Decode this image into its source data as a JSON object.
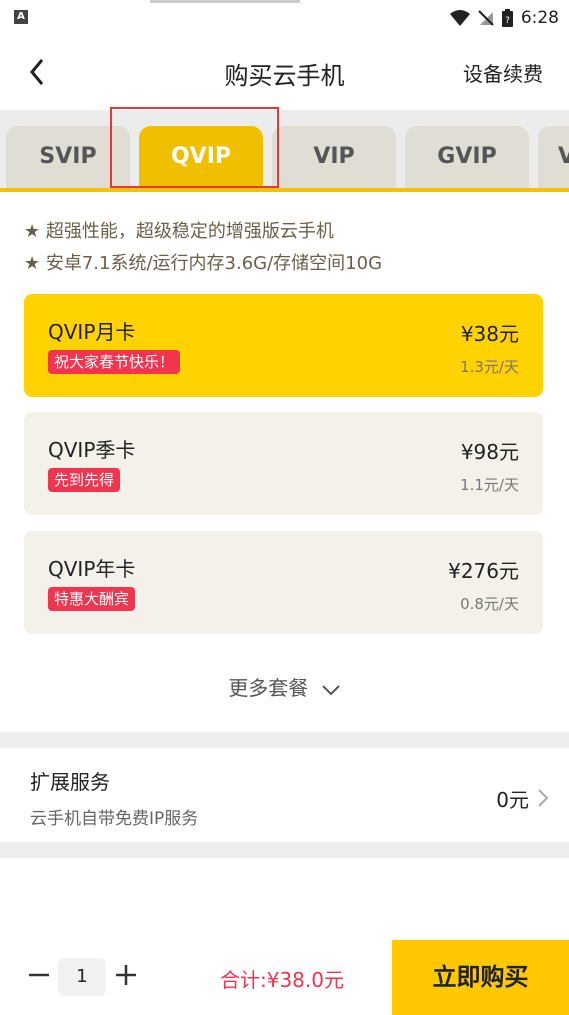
{
  "status_bar": {
    "time": "6:28"
  },
  "nav": {
    "title": "购买云手机",
    "right_action": "设备续费"
  },
  "tabs": [
    {
      "label": "SVIP",
      "active": false
    },
    {
      "label": "QVIP",
      "active": true
    },
    {
      "label": "VIP",
      "active": false
    },
    {
      "label": "GVIP",
      "active": false
    },
    {
      "label": "V",
      "active": false
    }
  ],
  "features": [
    "★ 超强性能，超级稳定的增强版云手机",
    "★ 安卓7.1系统/运行内存3.6G/存储空间10G"
  ],
  "plans": [
    {
      "name": "QVIP月卡",
      "badge": "祝大家春节快乐！",
      "price": "¥38元",
      "daily": "1.3元/天",
      "selected": true
    },
    {
      "name": "QVIP季卡",
      "badge": "先到先得",
      "price": "¥98元",
      "daily": "1.1元/天",
      "selected": false
    },
    {
      "name": "QVIP年卡",
      "badge": "特惠大酬宾",
      "price": "¥276元",
      "daily": "0.8元/天",
      "selected": false
    }
  ],
  "more_label": "更多套餐",
  "extension": {
    "title": "扩展服务",
    "subtitle": "云手机自带免费IP服务",
    "price": "0元"
  },
  "bottom_bar": {
    "quantity": "1",
    "total": "合计:¥38.0元",
    "buy_label": "立即购买"
  },
  "colors": {
    "accent": "#ffd200",
    "tab_active": "#f0c000",
    "badge": "#f2354e",
    "buy": "#ffc800"
  }
}
